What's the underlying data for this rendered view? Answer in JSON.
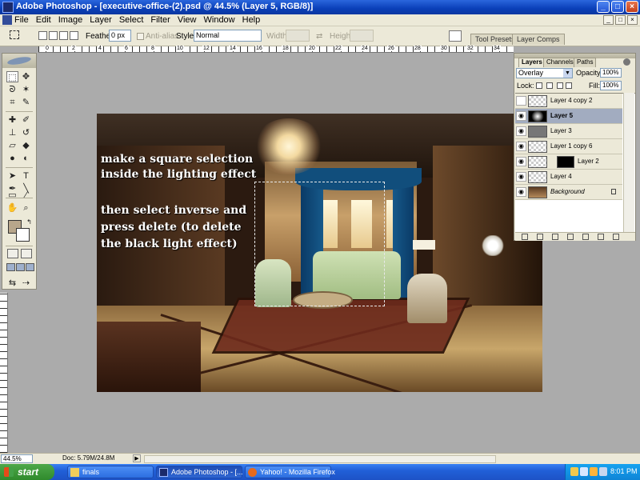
{
  "window": {
    "title": "Adobe Photoshop - [executive-office-(2).psd @ 44.5% (Layer 5, RGB/8)]",
    "minimize": "_",
    "maximize": "□",
    "close": "×"
  },
  "menu": {
    "items": [
      "File",
      "Edit",
      "Image",
      "Layer",
      "Select",
      "Filter",
      "View",
      "Window",
      "Help"
    ]
  },
  "options": {
    "feather_label": "Feather:",
    "feather_value": "0 px",
    "antialias_label": "Anti-alias",
    "style_label": "Style:",
    "style_value": "Normal",
    "width_label": "Width:",
    "height_label": "Height:",
    "palette_tabs": [
      "Tool Presets",
      "Layer Comps"
    ]
  },
  "ruler": {
    "numbers": [
      "0",
      "2",
      "4",
      "6",
      "8",
      "10",
      "12",
      "14",
      "16",
      "18",
      "20",
      "22",
      "24",
      "26",
      "28",
      "30",
      "32",
      "34"
    ]
  },
  "canvas": {
    "instructions": [
      "make a square selection",
      "inside the lighting effect",
      "",
      "then select inverse and",
      "press delete (to delete",
      "the black light effect)"
    ]
  },
  "layers_panel": {
    "tabs": [
      "Layers",
      "Channels",
      "Paths"
    ],
    "blend_mode": "Overlay",
    "opacity_label": "Opacity:",
    "opacity_value": "100%",
    "lock_label": "Lock:",
    "fill_label": "Fill:",
    "fill_value": "100%",
    "layers": [
      {
        "name": "Layer 4 copy 2",
        "visible": false,
        "selected": false
      },
      {
        "name": "Layer 5",
        "visible": true,
        "selected": true
      },
      {
        "name": "Layer 3",
        "visible": true,
        "selected": false
      },
      {
        "name": "Layer 1 copy 6",
        "visible": true,
        "selected": false
      },
      {
        "name": "Layer 2",
        "visible": true,
        "selected": false
      },
      {
        "name": "Layer 4",
        "visible": true,
        "selected": false
      },
      {
        "name": "Background",
        "visible": true,
        "selected": false
      }
    ]
  },
  "status": {
    "zoom": "44.5%",
    "doc_info": "Doc: 5.79M/24.8M"
  },
  "taskbar": {
    "start_label": "start",
    "tasks": [
      "finals",
      "Adobe Photoshop - [...",
      "Yahoo! - Mozilla Firefox"
    ],
    "clock": "8:01 PM"
  },
  "colors": {
    "foreground_swatch": "#b8a68b",
    "background_swatch": "#ffffff",
    "xp_title_blue": "#0a3fb8",
    "selected_layer": "#a2acc0"
  }
}
